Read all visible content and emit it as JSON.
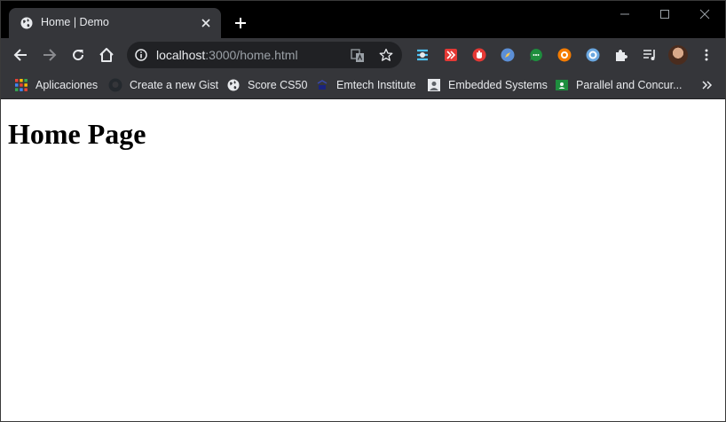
{
  "tab": {
    "title": "Home | Demo",
    "favicon": "globe-icon"
  },
  "omnibox": {
    "url_host": "localhost",
    "url_rest": ":3000/home.html"
  },
  "bookmarks": [
    {
      "label": "Aplicaciones",
      "icon": "apps-grid-icon"
    },
    {
      "label": "Create a new Gist",
      "icon": "github-icon"
    },
    {
      "label": "Score CS50",
      "icon": "globe-icon"
    },
    {
      "label": "Emtech Institute",
      "icon": "emtech-icon"
    },
    {
      "label": "Embedded Systems",
      "icon": "portrait-icon"
    },
    {
      "label": "Parallel and Concur...",
      "icon": "classroom-icon"
    }
  ],
  "page": {
    "heading": "Home Page"
  },
  "colors": {
    "tab_strip": "#000000",
    "toolbar": "#35363a",
    "omnibox": "#202124",
    "text_light": "#e8eaed",
    "text_dim": "#9aa0a6",
    "page_bg": "#ffffff"
  }
}
